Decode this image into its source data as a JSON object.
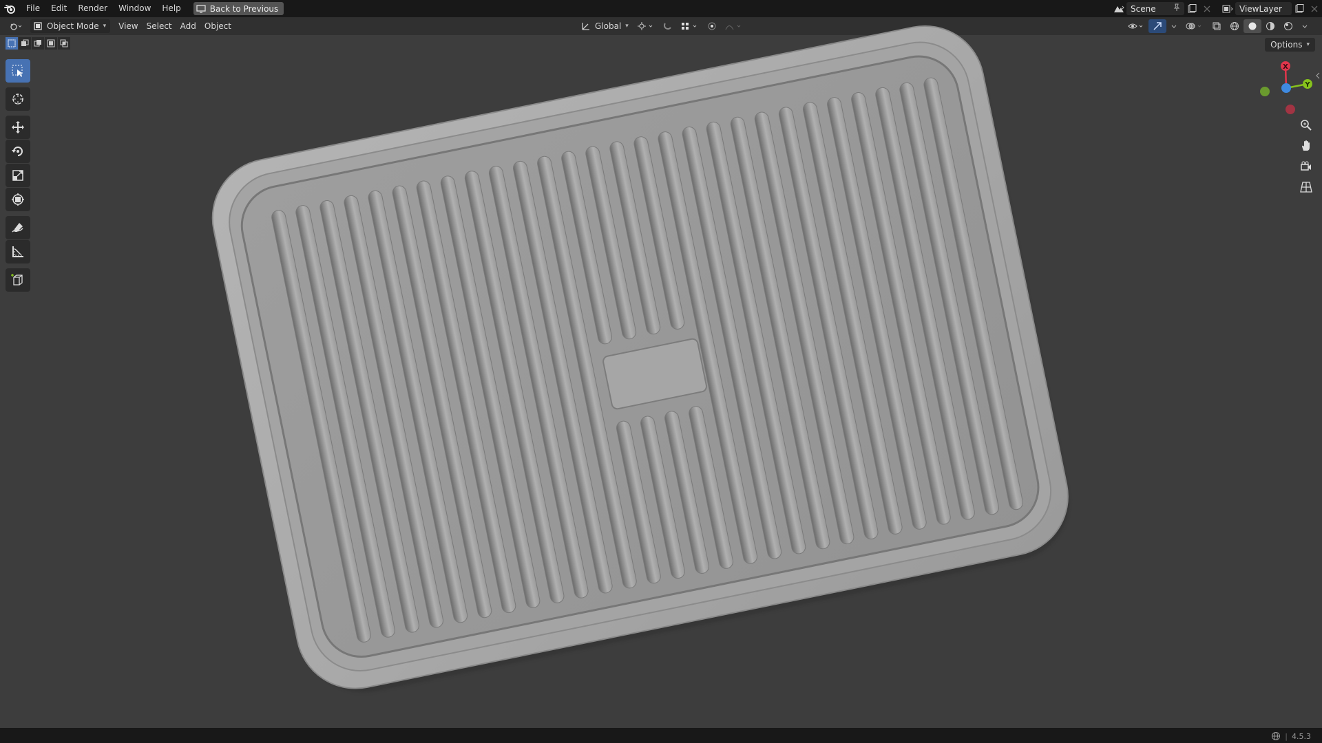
{
  "topbar": {
    "menus": [
      "File",
      "Edit",
      "Render",
      "Window",
      "Help"
    ],
    "back_button": "Back to Previous",
    "scene_name": "Scene",
    "view_layer": "ViewLayer"
  },
  "header": {
    "mode": "Object Mode",
    "menus": [
      "View",
      "Select",
      "Add",
      "Object"
    ],
    "transform_orientation": "Global"
  },
  "viewport": {
    "options_label": "Options",
    "gizmo_axes": [
      "X",
      "Y"
    ]
  },
  "toolbar": {
    "tools": [
      "select-box",
      "cursor",
      "move",
      "rotate",
      "scale",
      "transform",
      "annotate",
      "measure",
      "add-cube"
    ],
    "active_tool": "select-box"
  },
  "status": {
    "version": "4.5.3"
  },
  "colors": {
    "accent": "#4772b3",
    "axis_x": "#e2364c",
    "axis_y": "#86c21c",
    "axis_z": "#3f8ae0",
    "background": "#3d3d3d"
  }
}
